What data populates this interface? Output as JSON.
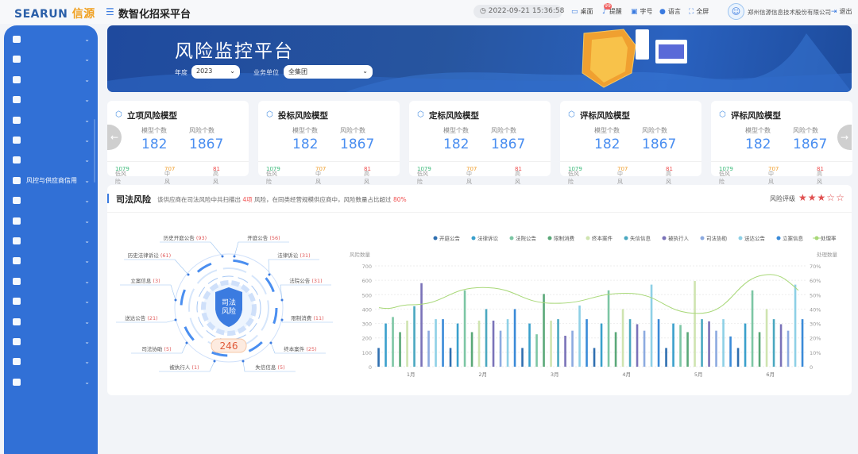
{
  "header": {
    "logo": "SEARUN",
    "logo_cn": "信源",
    "title": "数智化招采平台",
    "datetime": "2022-09-21 15:36:58",
    "tools": [
      {
        "icon": "desktop-icon",
        "label": "桌面"
      },
      {
        "icon": "bell-icon",
        "label": "提醒"
      },
      {
        "icon": "font-size-icon",
        "label": "字号"
      },
      {
        "icon": "globe-icon",
        "label": "语言"
      },
      {
        "icon": "fullscreen-icon",
        "label": "全屏"
      }
    ],
    "notification_badge": "99",
    "company": "郑州信源信息技术股份有限公司",
    "logout": "退出"
  },
  "sidebar": {
    "items": [
      {
        "icon": "grid-icon",
        "label": ""
      },
      {
        "icon": "calendar-icon",
        "label": ""
      },
      {
        "icon": "edit-doc-icon",
        "label": ""
      },
      {
        "icon": "briefcase-icon",
        "label": ""
      },
      {
        "icon": "doc-settings-icon",
        "label": ""
      },
      {
        "icon": "user-card-icon",
        "label": ""
      },
      {
        "icon": "report-icon",
        "label": ""
      },
      {
        "icon": "shield-icon",
        "label": "风控与供应商信用"
      },
      {
        "icon": "search-icon",
        "label": ""
      },
      {
        "icon": "chart-icon",
        "label": ""
      },
      {
        "icon": "box-icon",
        "label": ""
      },
      {
        "icon": "cube-icon",
        "label": ""
      },
      {
        "icon": "monitor-icon",
        "label": ""
      },
      {
        "icon": "circle-icon",
        "label": ""
      },
      {
        "icon": "lock-icon",
        "label": ""
      },
      {
        "icon": "gear-icon",
        "label": ""
      },
      {
        "icon": "lock-doc-icon",
        "label": ""
      },
      {
        "icon": "dashboard-icon",
        "label": ""
      }
    ]
  },
  "banner": {
    "title": "风险监控平台",
    "year_label": "年度",
    "year_value": "2023",
    "unit_label": "业务单位",
    "unit_value": "全集团"
  },
  "cards": [
    {
      "title": "立项风险模型",
      "model_label": "模型个数",
      "model_count": "182",
      "risk_label": "风险个数",
      "risk_count": "1867",
      "low_label": "低风险",
      "low": "1079",
      "mid_label": "中风险",
      "mid": "707",
      "high_label": "高风险",
      "high": "81"
    },
    {
      "title": "投标风险模型",
      "model_label": "模型个数",
      "model_count": "182",
      "risk_label": "风险个数",
      "risk_count": "1867",
      "low_label": "低风险",
      "low": "1079",
      "mid_label": "中风险",
      "mid": "707",
      "high_label": "高风险",
      "high": "81"
    },
    {
      "title": "定标风险模型",
      "model_label": "模型个数",
      "model_count": "182",
      "risk_label": "风险个数",
      "risk_count": "1867",
      "low_label": "低风险",
      "low": "1079",
      "mid_label": "中风险",
      "mid": "707",
      "high_label": "高风险",
      "high": "81"
    },
    {
      "title": "评标风险模型",
      "model_label": "模型个数",
      "model_count": "182",
      "risk_label": "风险个数",
      "risk_count": "1867",
      "low_label": "低风险",
      "low": "1079",
      "mid_label": "中风险",
      "mid": "707",
      "high_label": "高风险",
      "high": "81"
    },
    {
      "title": "评标风险模型",
      "model_label": "模型个数",
      "model_count": "182",
      "risk_label": "风险个数",
      "risk_count": "1867",
      "low_label": "低风险",
      "low": "1079",
      "mid_label": "中风险",
      "mid": "707",
      "high_label": "高风险",
      "high": "81"
    }
  ],
  "judicial": {
    "title": "司法风险",
    "desc_pre": "该供应商在司法风险中共扫描出 ",
    "desc_count": "4项",
    "desc_mid": " 风险，在同类经营规模供应商中，风险数量占比超过 ",
    "desc_pct": "80%",
    "rating_label": "风险评级",
    "rating": 3,
    "rating_max": 5,
    "center_label": "司法\n风险",
    "total": "246",
    "items": [
      {
        "name": "历史开庭公告",
        "count": "(93)"
      },
      {
        "name": "开庭公告",
        "count": "(56)"
      },
      {
        "name": "历史法律诉讼",
        "count": "(61)"
      },
      {
        "name": "法律诉讼",
        "count": "(31)"
      },
      {
        "name": "立案信息",
        "count": "(3)"
      },
      {
        "name": "法院公告",
        "count": "(31)"
      },
      {
        "name": "送达公告",
        "count": "(21)"
      },
      {
        "name": "限制消费",
        "count": "(11)"
      },
      {
        "name": "司法协助",
        "count": "(5)"
      },
      {
        "name": "终本案件",
        "count": "(25)"
      },
      {
        "name": "被执行人",
        "count": "(1)"
      },
      {
        "name": "失信信息",
        "count": "(5)"
      }
    ]
  },
  "chart_data": {
    "type": "bar",
    "categories": [
      "1月",
      "2月",
      "3月",
      "4月",
      "5月",
      "6月"
    ],
    "ylabel": "风险数量",
    "ylim": [
      0,
      700
    ],
    "yticks": [
      "0",
      "100",
      "200",
      "300",
      "400",
      "500",
      "600",
      "700"
    ],
    "y2label": "处理数量",
    "y2lim": [
      0,
      70
    ],
    "y2ticks": [
      "0",
      "10%",
      "20%",
      "30%",
      "40%",
      "50%",
      "60%",
      "70%"
    ],
    "legend_position": "top-right",
    "grid": true,
    "series": [
      {
        "name": "开庭公告",
        "color": "#2f6fb0",
        "values": [
          130,
          130,
          130,
          130,
          130,
          130
        ]
      },
      {
        "name": "法律诉讼",
        "color": "#3aa0cc",
        "values": [
          300,
          300,
          300,
          300,
          300,
          300
        ]
      },
      {
        "name": "法院公告",
        "color": "#7cc6a4",
        "values": [
          345,
          530,
          225,
          530,
          290,
          530
        ]
      },
      {
        "name": "限制消费",
        "color": "#5aa878",
        "values": [
          240,
          240,
          505,
          240,
          240,
          240
        ]
      },
      {
        "name": "终本案件",
        "color": "#cfe4b0",
        "values": [
          320,
          320,
          320,
          400,
          595,
          400
        ]
      },
      {
        "name": "失信信息",
        "color": "#4aa8c0",
        "values": [
          420,
          400,
          330,
          330,
          330,
          330
        ]
      },
      {
        "name": "被执行人",
        "color": "#7a72b8",
        "values": [
          580,
          320,
          215,
          295,
          315,
          295
        ]
      },
      {
        "name": "司法协助",
        "color": "#8caae0",
        "values": [
          250,
          250,
          250,
          250,
          250,
          250
        ]
      },
      {
        "name": "送达公告",
        "color": "#8ed0e6",
        "values": [
          330,
          330,
          425,
          570,
          330,
          570
        ]
      },
      {
        "name": "立案信息",
        "color": "#3a8ad8",
        "values": [
          330,
          400,
          330,
          330,
          210,
          330
        ]
      },
      {
        "name": "处理率",
        "color": "#a8d878",
        "type": "line",
        "axis": "right",
        "values": [
          43,
          55,
          44,
          51,
          37,
          64
        ]
      }
    ]
  }
}
